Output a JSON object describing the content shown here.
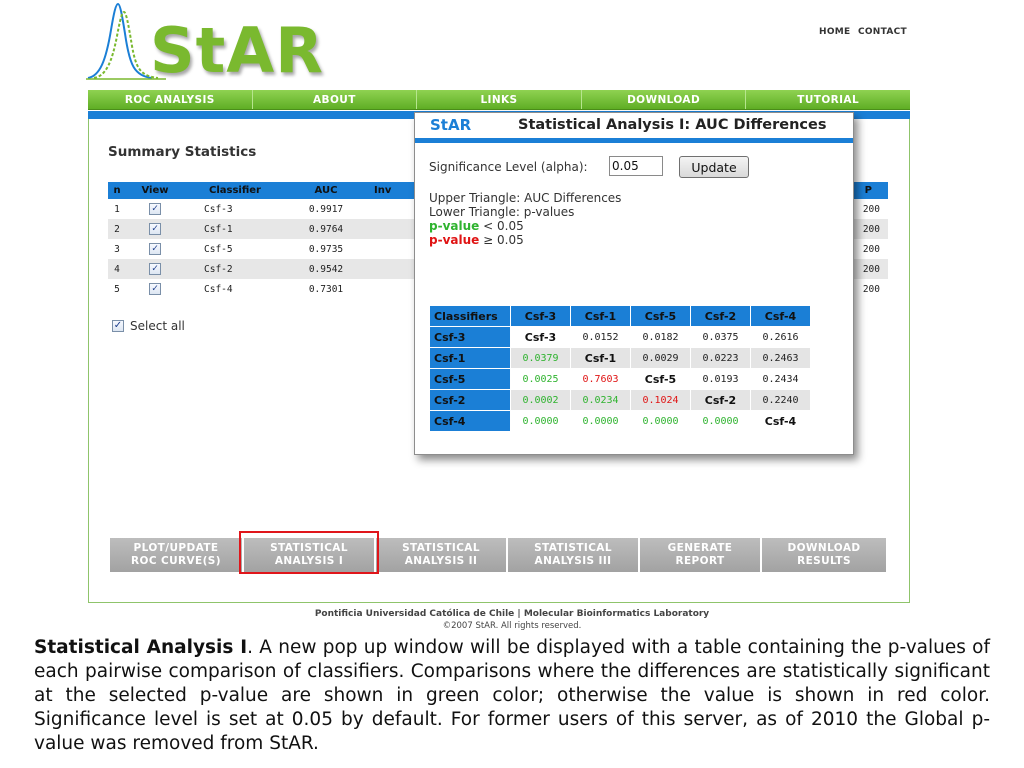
{
  "header": {
    "logo": "StAR",
    "top_links": [
      "HOME",
      "CONTACT"
    ]
  },
  "nav": [
    "ROC ANALYSIS",
    "ABOUT",
    "LINKS",
    "DOWNLOAD",
    "TUTORIAL"
  ],
  "summary": {
    "title": "Summary Statistics",
    "columns": [
      "n",
      "View",
      "Classifier",
      "AUC",
      "Inv",
      "P"
    ],
    "rows": [
      {
        "n": "1",
        "classifier": "Csf-3",
        "auc": "0.9917",
        "p": "200"
      },
      {
        "n": "2",
        "classifier": "Csf-1",
        "auc": "0.9764",
        "p": "200"
      },
      {
        "n": "3",
        "classifier": "Csf-5",
        "auc": "0.9735",
        "p": "200"
      },
      {
        "n": "4",
        "classifier": "Csf-2",
        "auc": "0.9542",
        "p": "200"
      },
      {
        "n": "5",
        "classifier": "Csf-4",
        "auc": "0.7301",
        "p": "200"
      }
    ],
    "select_all": "Select all"
  },
  "toolbar": [
    {
      "line1": "PLOT/UPDATE",
      "line2": "ROC CURVE(S)"
    },
    {
      "line1": "STATISTICAL",
      "line2": "ANALYSIS I"
    },
    {
      "line1": "STATISTICAL",
      "line2": "ANALYSIS II"
    },
    {
      "line1": "STATISTICAL",
      "line2": "ANALYSIS III"
    },
    {
      "line1": "GENERATE",
      "line2": "REPORT"
    },
    {
      "line1": "DOWNLOAD",
      "line2": "RESULTS"
    }
  ],
  "footer": {
    "line1": "Pontificia Universidad Católica de Chile  |  Molecular Bioinformatics Laboratory",
    "line2": "©2007 StAR. All rights reserved."
  },
  "popup": {
    "brand": "StAR",
    "title": "Statistical Analysis I: AUC Differences",
    "alpha_label": "Significance Level (alpha):",
    "alpha_value": "0.05",
    "update_label": "Update",
    "legend_upper": "Upper Triangle: AUC Differences",
    "legend_lower": "Lower Triangle: p-values",
    "legend_pv_word": "p-value",
    "legend_sig": "< 0.05",
    "legend_nsig": "≥ 0.05",
    "table_corner": "Classifiers",
    "classifiers": [
      "Csf-3",
      "Csf-1",
      "Csf-5",
      "Csf-2",
      "Csf-4"
    ],
    "matrix": [
      [
        "Csf-3",
        "0.0152",
        "0.0182",
        "0.0375",
        "0.2616"
      ],
      [
        "0.0379",
        "Csf-1",
        "0.0029",
        "0.0223",
        "0.2463"
      ],
      [
        "0.0025",
        "0.7603",
        "Csf-5",
        "0.0193",
        "0.2434"
      ],
      [
        "0.0002",
        "0.0234",
        "0.1024",
        "Csf-2",
        "0.2240"
      ],
      [
        "0.0000",
        "0.0000",
        "0.0000",
        "0.0000",
        "Csf-4"
      ]
    ],
    "alpha": 0.05
  },
  "caption": {
    "lead": "Statistical Analysis I",
    "body": ". A new pop up window will be displayed with a table containing the p-values of each pairwise comparison of classifiers. Comparisons where the differences are statistically significant at the selected p-value are shown in green color; otherwise the value is shown in red color. Significance level is set at 0.05 by default. For former users of this server, as of 2010 the Global p-value was removed from StAR."
  },
  "colors": {
    "accent_green": "#7ab92f",
    "accent_blue": "#1b7fd6",
    "significant": "#2fb32f",
    "not_significant": "#e01414",
    "highlight": "#e0161b"
  }
}
